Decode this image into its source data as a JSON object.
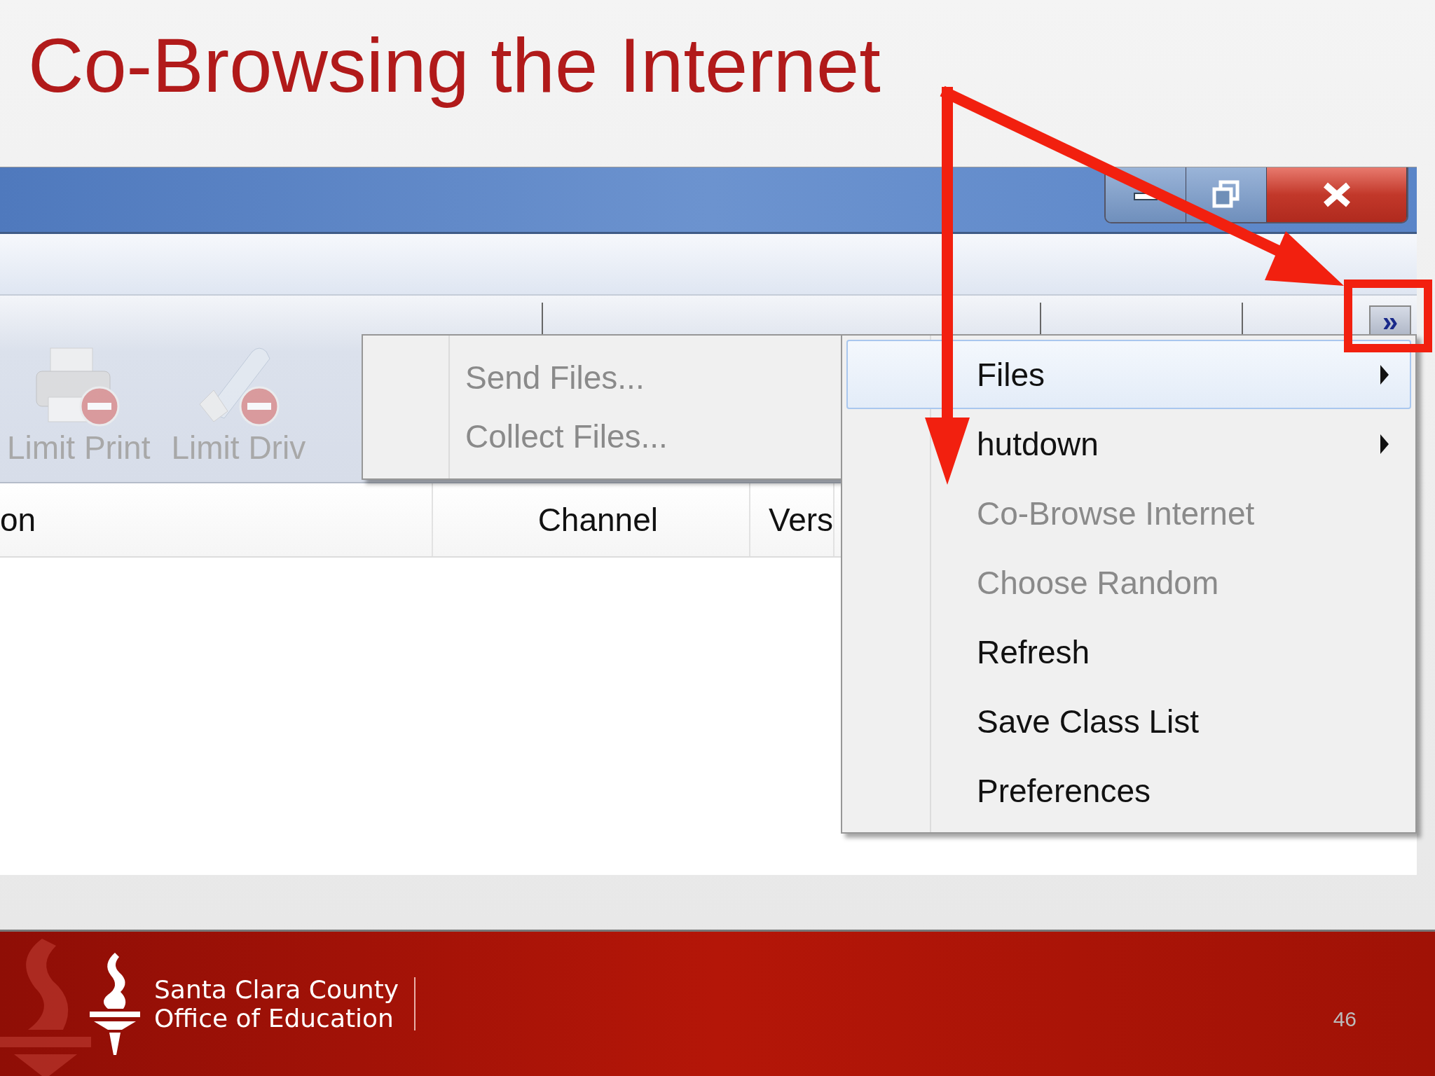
{
  "slide": {
    "title": "Co-Browsing the Internet",
    "page_number": "46"
  },
  "organization": {
    "lines": [
      "Santa Clara County",
      "Office of Education"
    ]
  },
  "window": {
    "buttons": [
      {
        "kind": "minimize"
      },
      {
        "kind": "restore"
      },
      {
        "kind": "close"
      }
    ]
  },
  "toolbar": {
    "items": [
      {
        "label": "Limit Print",
        "kind": "printer",
        "disabled": true
      },
      {
        "label": "Limit Driv",
        "kind": "drive",
        "disabled": true
      }
    ],
    "overflow_button": {
      "label": "»"
    }
  },
  "table": {
    "columns": [
      "on",
      "Channel",
      "Vers"
    ]
  },
  "submenu": {
    "items": [
      {
        "label": "Send Files...",
        "disabled": true
      },
      {
        "label": "Collect Files...",
        "disabled": true
      }
    ]
  },
  "context_menu": {
    "items": [
      {
        "label": "Files",
        "has_submenu": true,
        "selected": true,
        "disabled": false
      },
      {
        "label": "hutdown",
        "has_submenu": true,
        "selected": false,
        "disabled": false
      },
      {
        "label": "Co-Browse Internet",
        "has_submenu": false,
        "selected": false,
        "disabled": true
      },
      {
        "label": "Choose Random",
        "has_submenu": false,
        "selected": false,
        "disabled": true
      },
      {
        "label": "Refresh",
        "has_submenu": false,
        "selected": false,
        "disabled": false
      },
      {
        "label": "Save Class List",
        "has_submenu": false,
        "selected": false,
        "disabled": false
      },
      {
        "label": "Preferences",
        "has_submenu": false,
        "selected": false,
        "disabled": false
      }
    ]
  }
}
